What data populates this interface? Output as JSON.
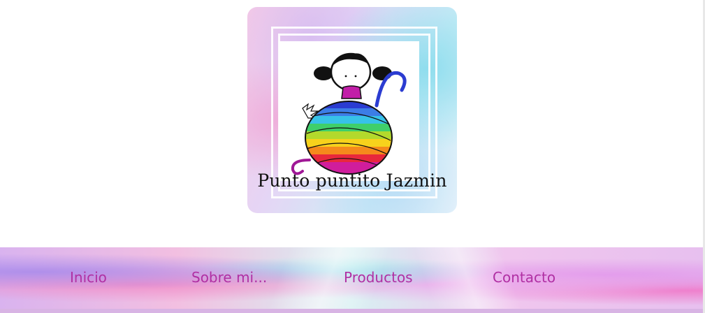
{
  "brand": {
    "title": "Punto puntito Jazmin",
    "logo_icon": "girl-with-yarn-ball-logo"
  },
  "nav": {
    "items": [
      {
        "label": "Inicio"
      },
      {
        "label": "Sobre mi..."
      },
      {
        "label": "Productos"
      },
      {
        "label": "Contacto"
      }
    ]
  },
  "colors": {
    "nav_text": "#b02fa3",
    "title_text": "#111111"
  }
}
